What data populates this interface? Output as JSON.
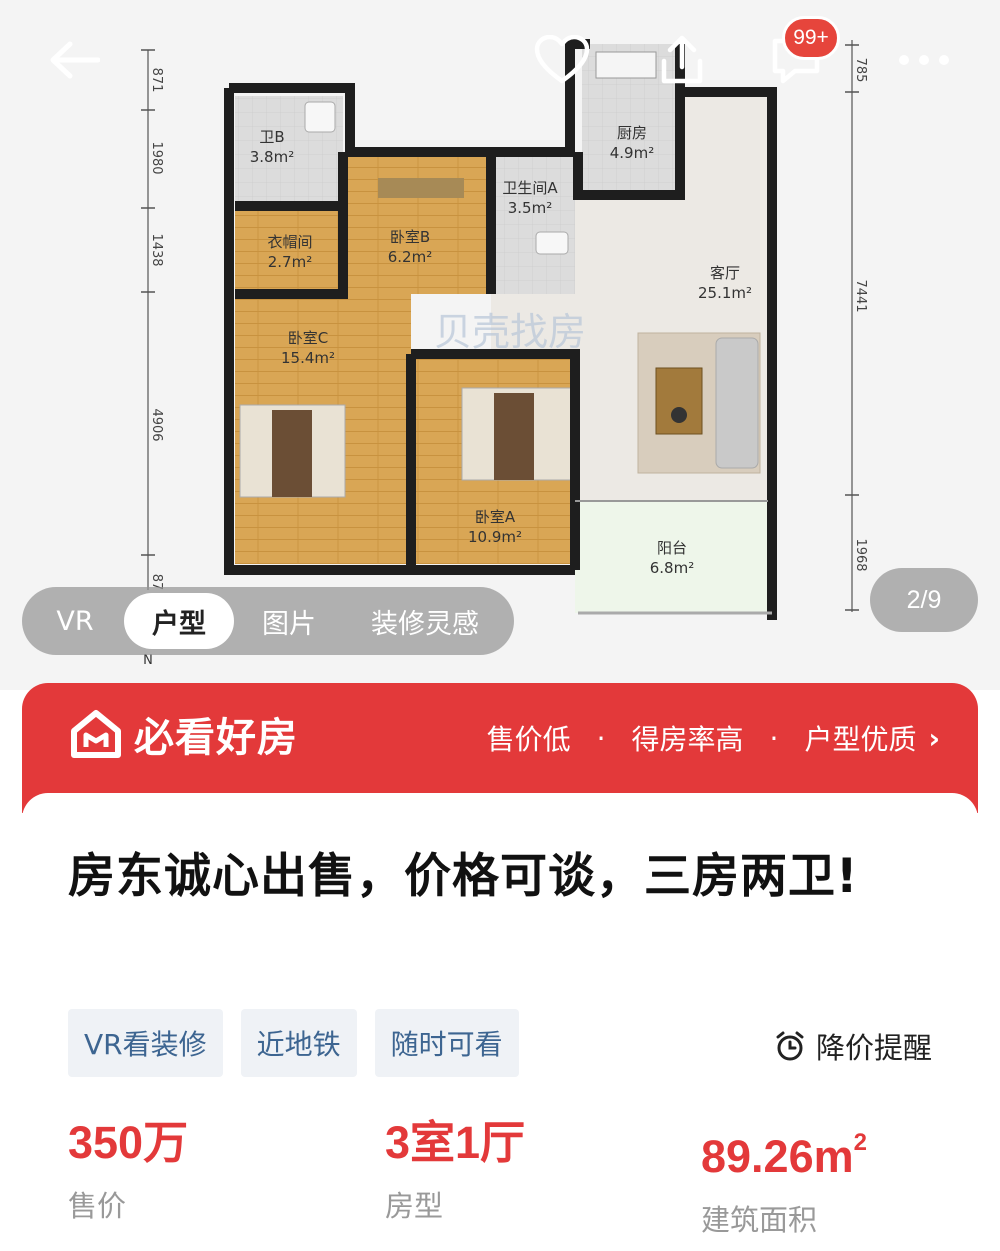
{
  "floorplan": {
    "rooms": [
      {
        "name": "卫B",
        "area": "3.8m²"
      },
      {
        "name": "衣帽间",
        "area": "2.7m²"
      },
      {
        "name": "卧室B",
        "area": "6.2m²"
      },
      {
        "name": "卫生间A",
        "area": "3.5m²"
      },
      {
        "name": "厨房",
        "area": "4.9m²"
      },
      {
        "name": "客厅",
        "area": "25.1m²"
      },
      {
        "name": "卧室C",
        "area": "15.4m²"
      },
      {
        "name": "卧室A",
        "area": "10.9m²"
      },
      {
        "name": "阳台",
        "area": "6.8m²"
      }
    ],
    "dimensions_left": [
      "871",
      "1980",
      "1438",
      "4906",
      "87"
    ],
    "dimensions_right": [
      "785",
      "7441",
      "1968"
    ],
    "compass_label": "N",
    "watermark": "贝壳找房"
  },
  "badge": "99+",
  "mode_tabs": [
    "VR",
    "户型",
    "图片",
    "装修灵感"
  ],
  "active_tab": "户型",
  "page_counter": "2/9",
  "banner": {
    "brand": "必看好房",
    "tags": [
      "售价低",
      "得房率高",
      "户型优质"
    ],
    "separator": "·",
    "chevron": "›"
  },
  "listing": {
    "title": "房东诚心出售，价格可谈，三房两卫!",
    "chips": [
      "VR看装修",
      "近地铁",
      "随时可看"
    ],
    "price_alert": "降价提醒",
    "stats": [
      {
        "value": "350万",
        "label": "售价"
      },
      {
        "value": "3室1厅",
        "label": "房型"
      },
      {
        "value": "89.26m",
        "sup": "2",
        "label": "建筑面积"
      }
    ]
  },
  "colors": {
    "accent": "#e3393a",
    "chip_text": "#3d6591",
    "chip_bg": "#eff2f6",
    "floor_wood": "#d8a453",
    "wall": "#1e1e1e"
  }
}
